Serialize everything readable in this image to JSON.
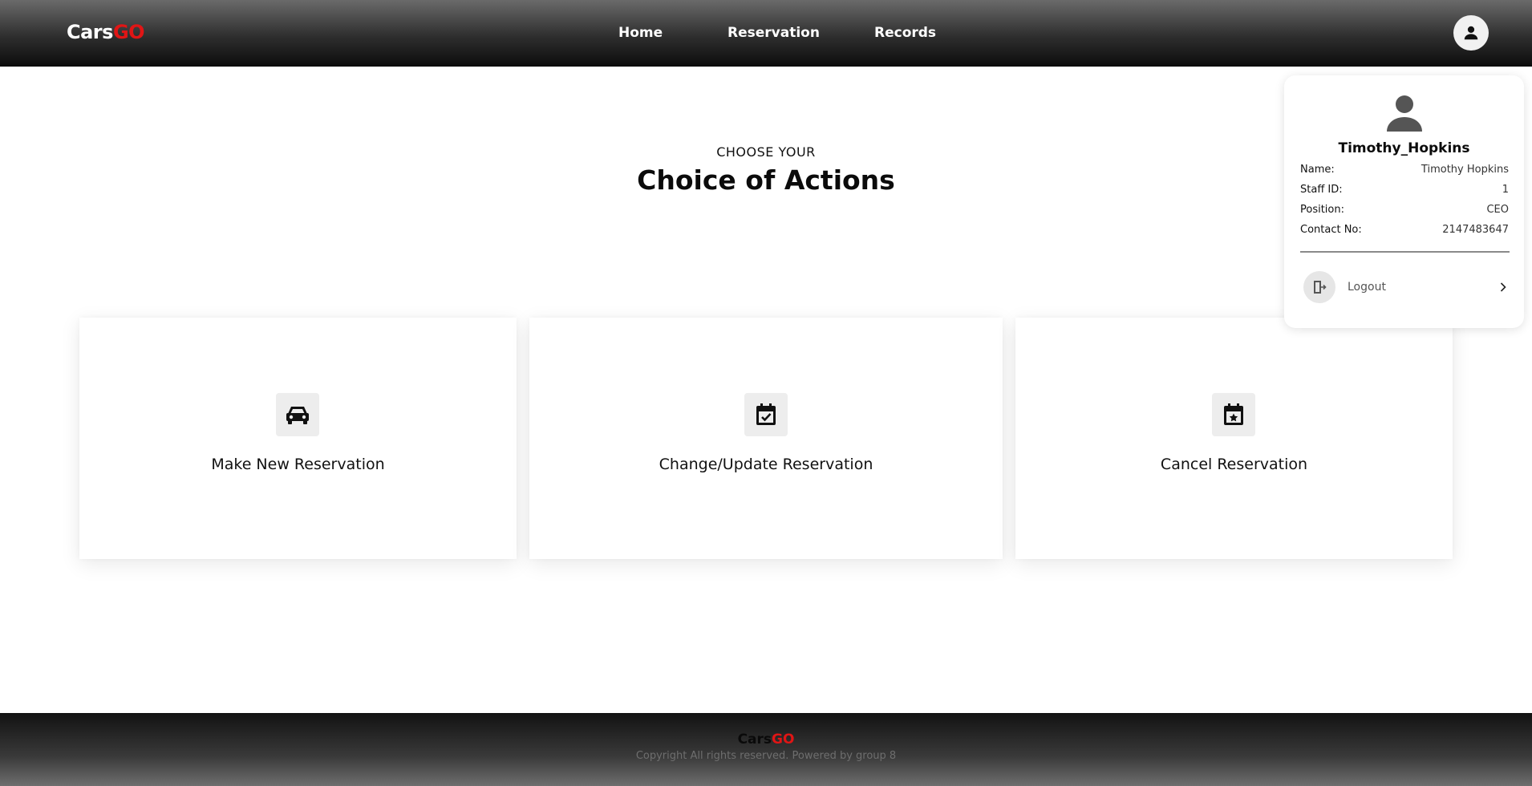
{
  "header": {
    "logo_part1": "Cars",
    "logo_part2": "GO",
    "nav": [
      {
        "label": "Home"
      },
      {
        "label": "Reservation"
      },
      {
        "label": "Records"
      }
    ]
  },
  "main": {
    "subtitle": "CHOOSE YOUR",
    "title": "Choice of Actions",
    "cards": [
      {
        "label": "Make New Reservation",
        "icon": "car-icon"
      },
      {
        "label": "Change/Update Reservation",
        "icon": "calendar-check-icon"
      },
      {
        "label": "Cancel Reservation",
        "icon": "calendar-star-icon"
      }
    ]
  },
  "profile": {
    "username": "Timothy_Hopkins",
    "rows": [
      {
        "key": "Name:",
        "value": "Timothy Hopkins"
      },
      {
        "key": "Staff ID:",
        "value": "1"
      },
      {
        "key": "Position:",
        "value": "CEO"
      },
      {
        "key": "Contact No:",
        "value": "2147483647"
      }
    ],
    "logout_label": "Logout"
  },
  "footer": {
    "logo_part1": "Cars",
    "logo_part2": "GO",
    "copyright": "Copyright All rights reserved. Powered by group 8"
  },
  "colors": {
    "accent": "#e01515",
    "header_dark": "#0c0c0c",
    "header_light": "#6a6a6a"
  }
}
